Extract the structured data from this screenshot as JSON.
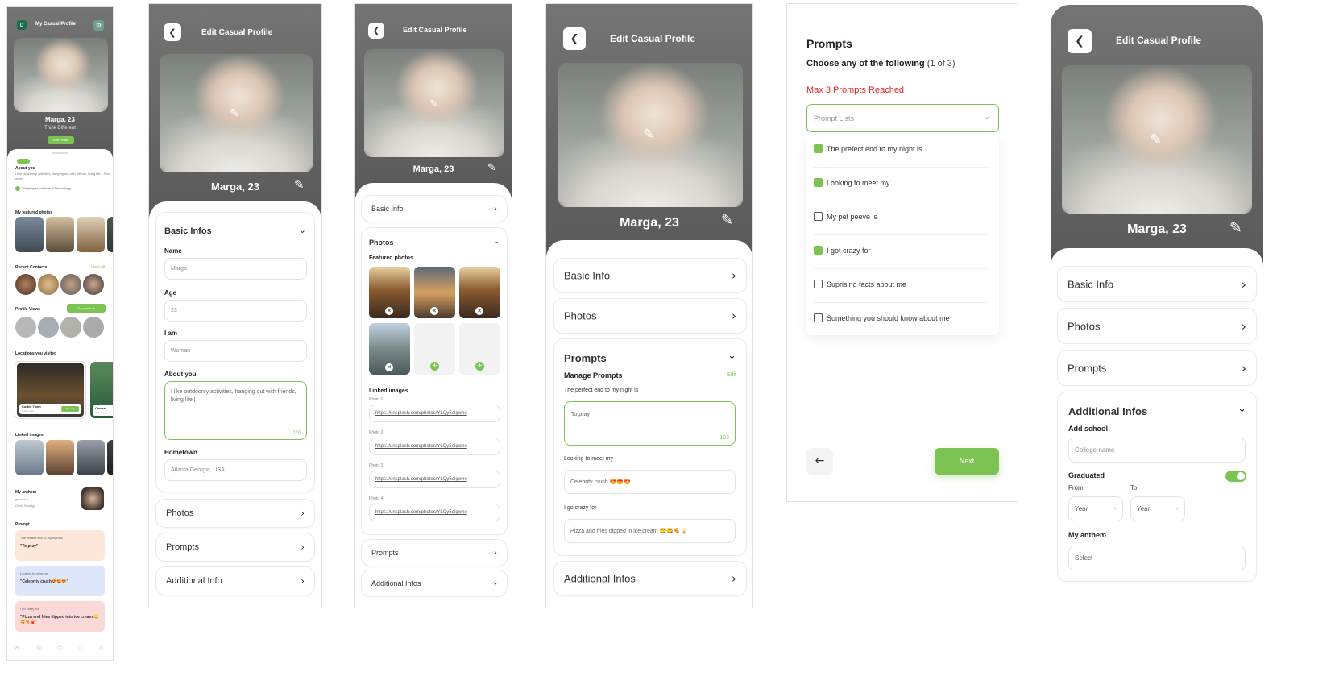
{
  "s1": {
    "title": "My Casual Profile",
    "name": "Marga, 23",
    "tagline": "Think Different",
    "edit_btn": "Edit Profile",
    "about_title": "About you",
    "about_text": "I like outdoorsy activities, hanging out with friends, living life... See more",
    "school": "Studying at Institute of Technology",
    "featured_title": "My featured photos",
    "contacts_title": "Recent Contacts",
    "view_all": "View all",
    "views_title": "Profile Views",
    "premium": "Go premium",
    "locations_title": "Locations you visited",
    "loc_name": "Coffee Town",
    "loc_sub": "3 days ago",
    "loc_btn": "On map",
    "loc2_name": "Central",
    "loc2_sub": "2 days ago",
    "linked_title": "Linked images",
    "anthem_title": "My anthem",
    "anthem_song": "good 4 u",
    "anthem_artist": "Olivia Rodrigo",
    "prompt_title": "Prompt",
    "p1_q": "The prefect end to my night is",
    "p1_a": "\"To pray\"",
    "p2_q": "Looking to meet my",
    "p2_a": "\"Celebrity crush😍😍😍\"",
    "p3_q": "I go crazy for",
    "p3_a": "\"Pizza and fries dipped into ice cream 😋😋🍕🍟\""
  },
  "s2": {
    "title": "Edit Casual Profile",
    "name": "Marga, 23",
    "basic": "Basic Infos",
    "name_label": "Name",
    "name_val": "Marga",
    "age_label": "Age",
    "age_val": "23",
    "iam_label": "I am",
    "iam_val": "Woman",
    "about_label": "About you",
    "about_val": "I like outdoorsy activities, hanging out with friends, living life |",
    "count": "103",
    "home_label": "Hometown",
    "home_val": "Atlanta Georgia, USA",
    "photos": "Photos",
    "prompts": "Prompts",
    "additional": "Additional Info"
  },
  "s3": {
    "title": "Edit Casual Profile",
    "name": "Marga, 23",
    "basic": "Basic Info",
    "photos": "Photos",
    "featured": "Featured photos",
    "linked": "Linked images",
    "p1": "Photo 1",
    "p2": "Photo 2",
    "p3": "Photo 3",
    "p4": "Photo 4",
    "url": "https://unsplash.com/photos/YLQy5olgwho",
    "prompts": "Prompts",
    "additional": "Additional Infos"
  },
  "s4": {
    "title": "Edit Casual Profile",
    "name": "Marga, 23",
    "basic": "Basic Info",
    "photos": "Photos",
    "prompts": "Prompts",
    "manage": "Manage Prompts",
    "edit": "Edit",
    "q1": "The perfect end to my night is",
    "a1": "To pray",
    "count": "103",
    "q2": "Looking to meet my",
    "a2": "Celebrity crush 😍😍😍",
    "q3": "I go crazy for",
    "a3": "Pizza and fries dipped in ice cream 😋😋🍕🍦",
    "additional": "Additional Infos"
  },
  "s5": {
    "title": "Prompts",
    "subtitle": "Choose any of the following",
    "count": "(1 of 3)",
    "max": "Max 3 Prompts Reached",
    "placeholder": "Prompt Lists",
    "options": [
      "The prefect end to my night is",
      "Looking to meet my",
      "My pet peeve is",
      "I got crazy for",
      "Suprising facts about me",
      "Something you should know about me"
    ],
    "next": "Next"
  },
  "s6": {
    "title": "Edit Casual Profile",
    "name": "Marga, 23",
    "basic": "Basic Info",
    "photos": "Photos",
    "prompts": "Prompts",
    "additional": "Additional Infos",
    "school_label": "Add school",
    "school_ph": "College name",
    "grad": "Graduated",
    "from": "From",
    "to": "To",
    "year": "Year",
    "anthem": "My anthem",
    "select": "Select"
  },
  "colors": {
    "accent": "#7cc353",
    "header": "#666666",
    "alert": "#e02424"
  }
}
